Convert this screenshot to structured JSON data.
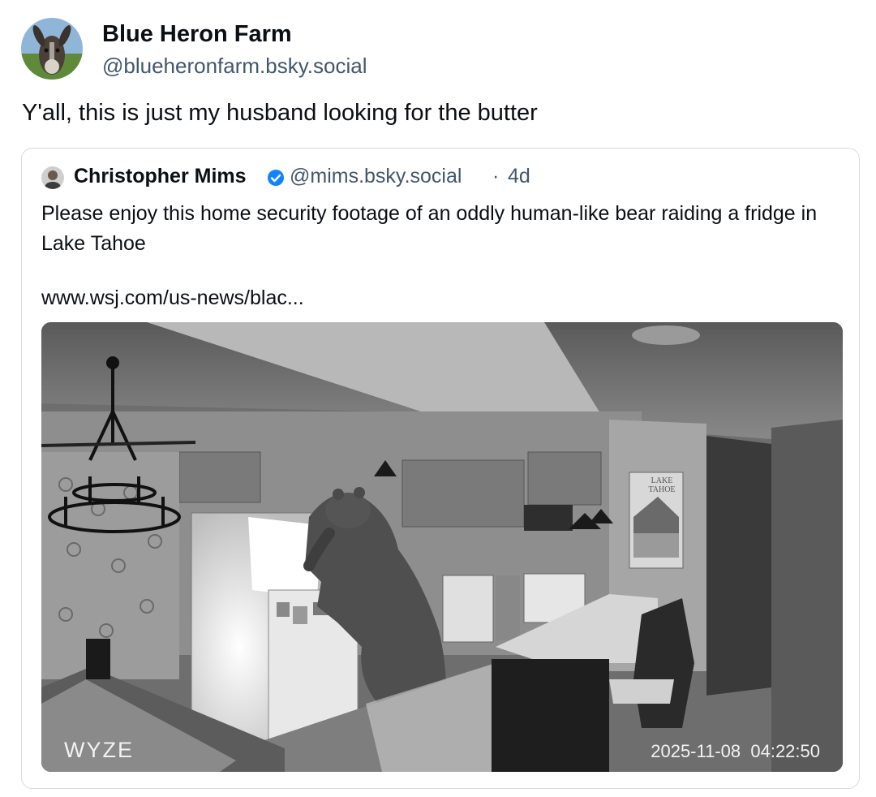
{
  "post": {
    "author_name": "Blue Heron Farm",
    "author_handle": "@blueheronfarm.bsky.social",
    "avatar_icon": "donkey-avatar-icon",
    "text": "Y'all, this is just my husband looking for the butter"
  },
  "quote": {
    "author_name": "Christopher Mims",
    "author_handle": "@mims.bsky.social",
    "separator": "·",
    "time": "4d",
    "verified_icon": "verified-check-icon",
    "verified_color": "#1083fe",
    "text": "Please enjoy this home security footage of an oddly human-like bear raiding a fridge in Lake Tahoe",
    "link": "www.wsj.com/us-news/blac...",
    "media": {
      "watermark": "WYZE",
      "timestamp": "2025-11-08  04:22:50",
      "sign_text": "LAKE TAHOE"
    }
  },
  "colors": {
    "text_primary": "#0b0f14",
    "text_secondary": "#42576c",
    "card_border": "#d4dbe2"
  }
}
